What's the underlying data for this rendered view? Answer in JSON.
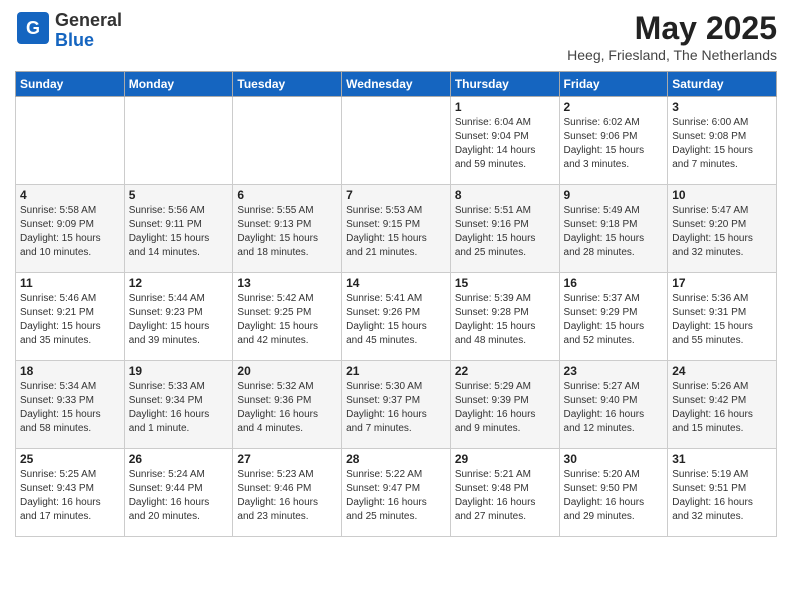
{
  "logo": {
    "general": "General",
    "blue": "Blue"
  },
  "title": "May 2025",
  "location": "Heeg, Friesland, The Netherlands",
  "days_of_week": [
    "Sunday",
    "Monday",
    "Tuesday",
    "Wednesday",
    "Thursday",
    "Friday",
    "Saturday"
  ],
  "weeks": [
    [
      {
        "day": "",
        "info": ""
      },
      {
        "day": "",
        "info": ""
      },
      {
        "day": "",
        "info": ""
      },
      {
        "day": "",
        "info": ""
      },
      {
        "day": "1",
        "info": "Sunrise: 6:04 AM\nSunset: 9:04 PM\nDaylight: 14 hours\nand 59 minutes."
      },
      {
        "day": "2",
        "info": "Sunrise: 6:02 AM\nSunset: 9:06 PM\nDaylight: 15 hours\nand 3 minutes."
      },
      {
        "day": "3",
        "info": "Sunrise: 6:00 AM\nSunset: 9:08 PM\nDaylight: 15 hours\nand 7 minutes."
      }
    ],
    [
      {
        "day": "4",
        "info": "Sunrise: 5:58 AM\nSunset: 9:09 PM\nDaylight: 15 hours\nand 10 minutes."
      },
      {
        "day": "5",
        "info": "Sunrise: 5:56 AM\nSunset: 9:11 PM\nDaylight: 15 hours\nand 14 minutes."
      },
      {
        "day": "6",
        "info": "Sunrise: 5:55 AM\nSunset: 9:13 PM\nDaylight: 15 hours\nand 18 minutes."
      },
      {
        "day": "7",
        "info": "Sunrise: 5:53 AM\nSunset: 9:15 PM\nDaylight: 15 hours\nand 21 minutes."
      },
      {
        "day": "8",
        "info": "Sunrise: 5:51 AM\nSunset: 9:16 PM\nDaylight: 15 hours\nand 25 minutes."
      },
      {
        "day": "9",
        "info": "Sunrise: 5:49 AM\nSunset: 9:18 PM\nDaylight: 15 hours\nand 28 minutes."
      },
      {
        "day": "10",
        "info": "Sunrise: 5:47 AM\nSunset: 9:20 PM\nDaylight: 15 hours\nand 32 minutes."
      }
    ],
    [
      {
        "day": "11",
        "info": "Sunrise: 5:46 AM\nSunset: 9:21 PM\nDaylight: 15 hours\nand 35 minutes."
      },
      {
        "day": "12",
        "info": "Sunrise: 5:44 AM\nSunset: 9:23 PM\nDaylight: 15 hours\nand 39 minutes."
      },
      {
        "day": "13",
        "info": "Sunrise: 5:42 AM\nSunset: 9:25 PM\nDaylight: 15 hours\nand 42 minutes."
      },
      {
        "day": "14",
        "info": "Sunrise: 5:41 AM\nSunset: 9:26 PM\nDaylight: 15 hours\nand 45 minutes."
      },
      {
        "day": "15",
        "info": "Sunrise: 5:39 AM\nSunset: 9:28 PM\nDaylight: 15 hours\nand 48 minutes."
      },
      {
        "day": "16",
        "info": "Sunrise: 5:37 AM\nSunset: 9:29 PM\nDaylight: 15 hours\nand 52 minutes."
      },
      {
        "day": "17",
        "info": "Sunrise: 5:36 AM\nSunset: 9:31 PM\nDaylight: 15 hours\nand 55 minutes."
      }
    ],
    [
      {
        "day": "18",
        "info": "Sunrise: 5:34 AM\nSunset: 9:33 PM\nDaylight: 15 hours\nand 58 minutes."
      },
      {
        "day": "19",
        "info": "Sunrise: 5:33 AM\nSunset: 9:34 PM\nDaylight: 16 hours\nand 1 minute."
      },
      {
        "day": "20",
        "info": "Sunrise: 5:32 AM\nSunset: 9:36 PM\nDaylight: 16 hours\nand 4 minutes."
      },
      {
        "day": "21",
        "info": "Sunrise: 5:30 AM\nSunset: 9:37 PM\nDaylight: 16 hours\nand 7 minutes."
      },
      {
        "day": "22",
        "info": "Sunrise: 5:29 AM\nSunset: 9:39 PM\nDaylight: 16 hours\nand 9 minutes."
      },
      {
        "day": "23",
        "info": "Sunrise: 5:27 AM\nSunset: 9:40 PM\nDaylight: 16 hours\nand 12 minutes."
      },
      {
        "day": "24",
        "info": "Sunrise: 5:26 AM\nSunset: 9:42 PM\nDaylight: 16 hours\nand 15 minutes."
      }
    ],
    [
      {
        "day": "25",
        "info": "Sunrise: 5:25 AM\nSunset: 9:43 PM\nDaylight: 16 hours\nand 17 minutes."
      },
      {
        "day": "26",
        "info": "Sunrise: 5:24 AM\nSunset: 9:44 PM\nDaylight: 16 hours\nand 20 minutes."
      },
      {
        "day": "27",
        "info": "Sunrise: 5:23 AM\nSunset: 9:46 PM\nDaylight: 16 hours\nand 23 minutes."
      },
      {
        "day": "28",
        "info": "Sunrise: 5:22 AM\nSunset: 9:47 PM\nDaylight: 16 hours\nand 25 minutes."
      },
      {
        "day": "29",
        "info": "Sunrise: 5:21 AM\nSunset: 9:48 PM\nDaylight: 16 hours\nand 27 minutes."
      },
      {
        "day": "30",
        "info": "Sunrise: 5:20 AM\nSunset: 9:50 PM\nDaylight: 16 hours\nand 29 minutes."
      },
      {
        "day": "31",
        "info": "Sunrise: 5:19 AM\nSunset: 9:51 PM\nDaylight: 16 hours\nand 32 minutes."
      }
    ]
  ]
}
